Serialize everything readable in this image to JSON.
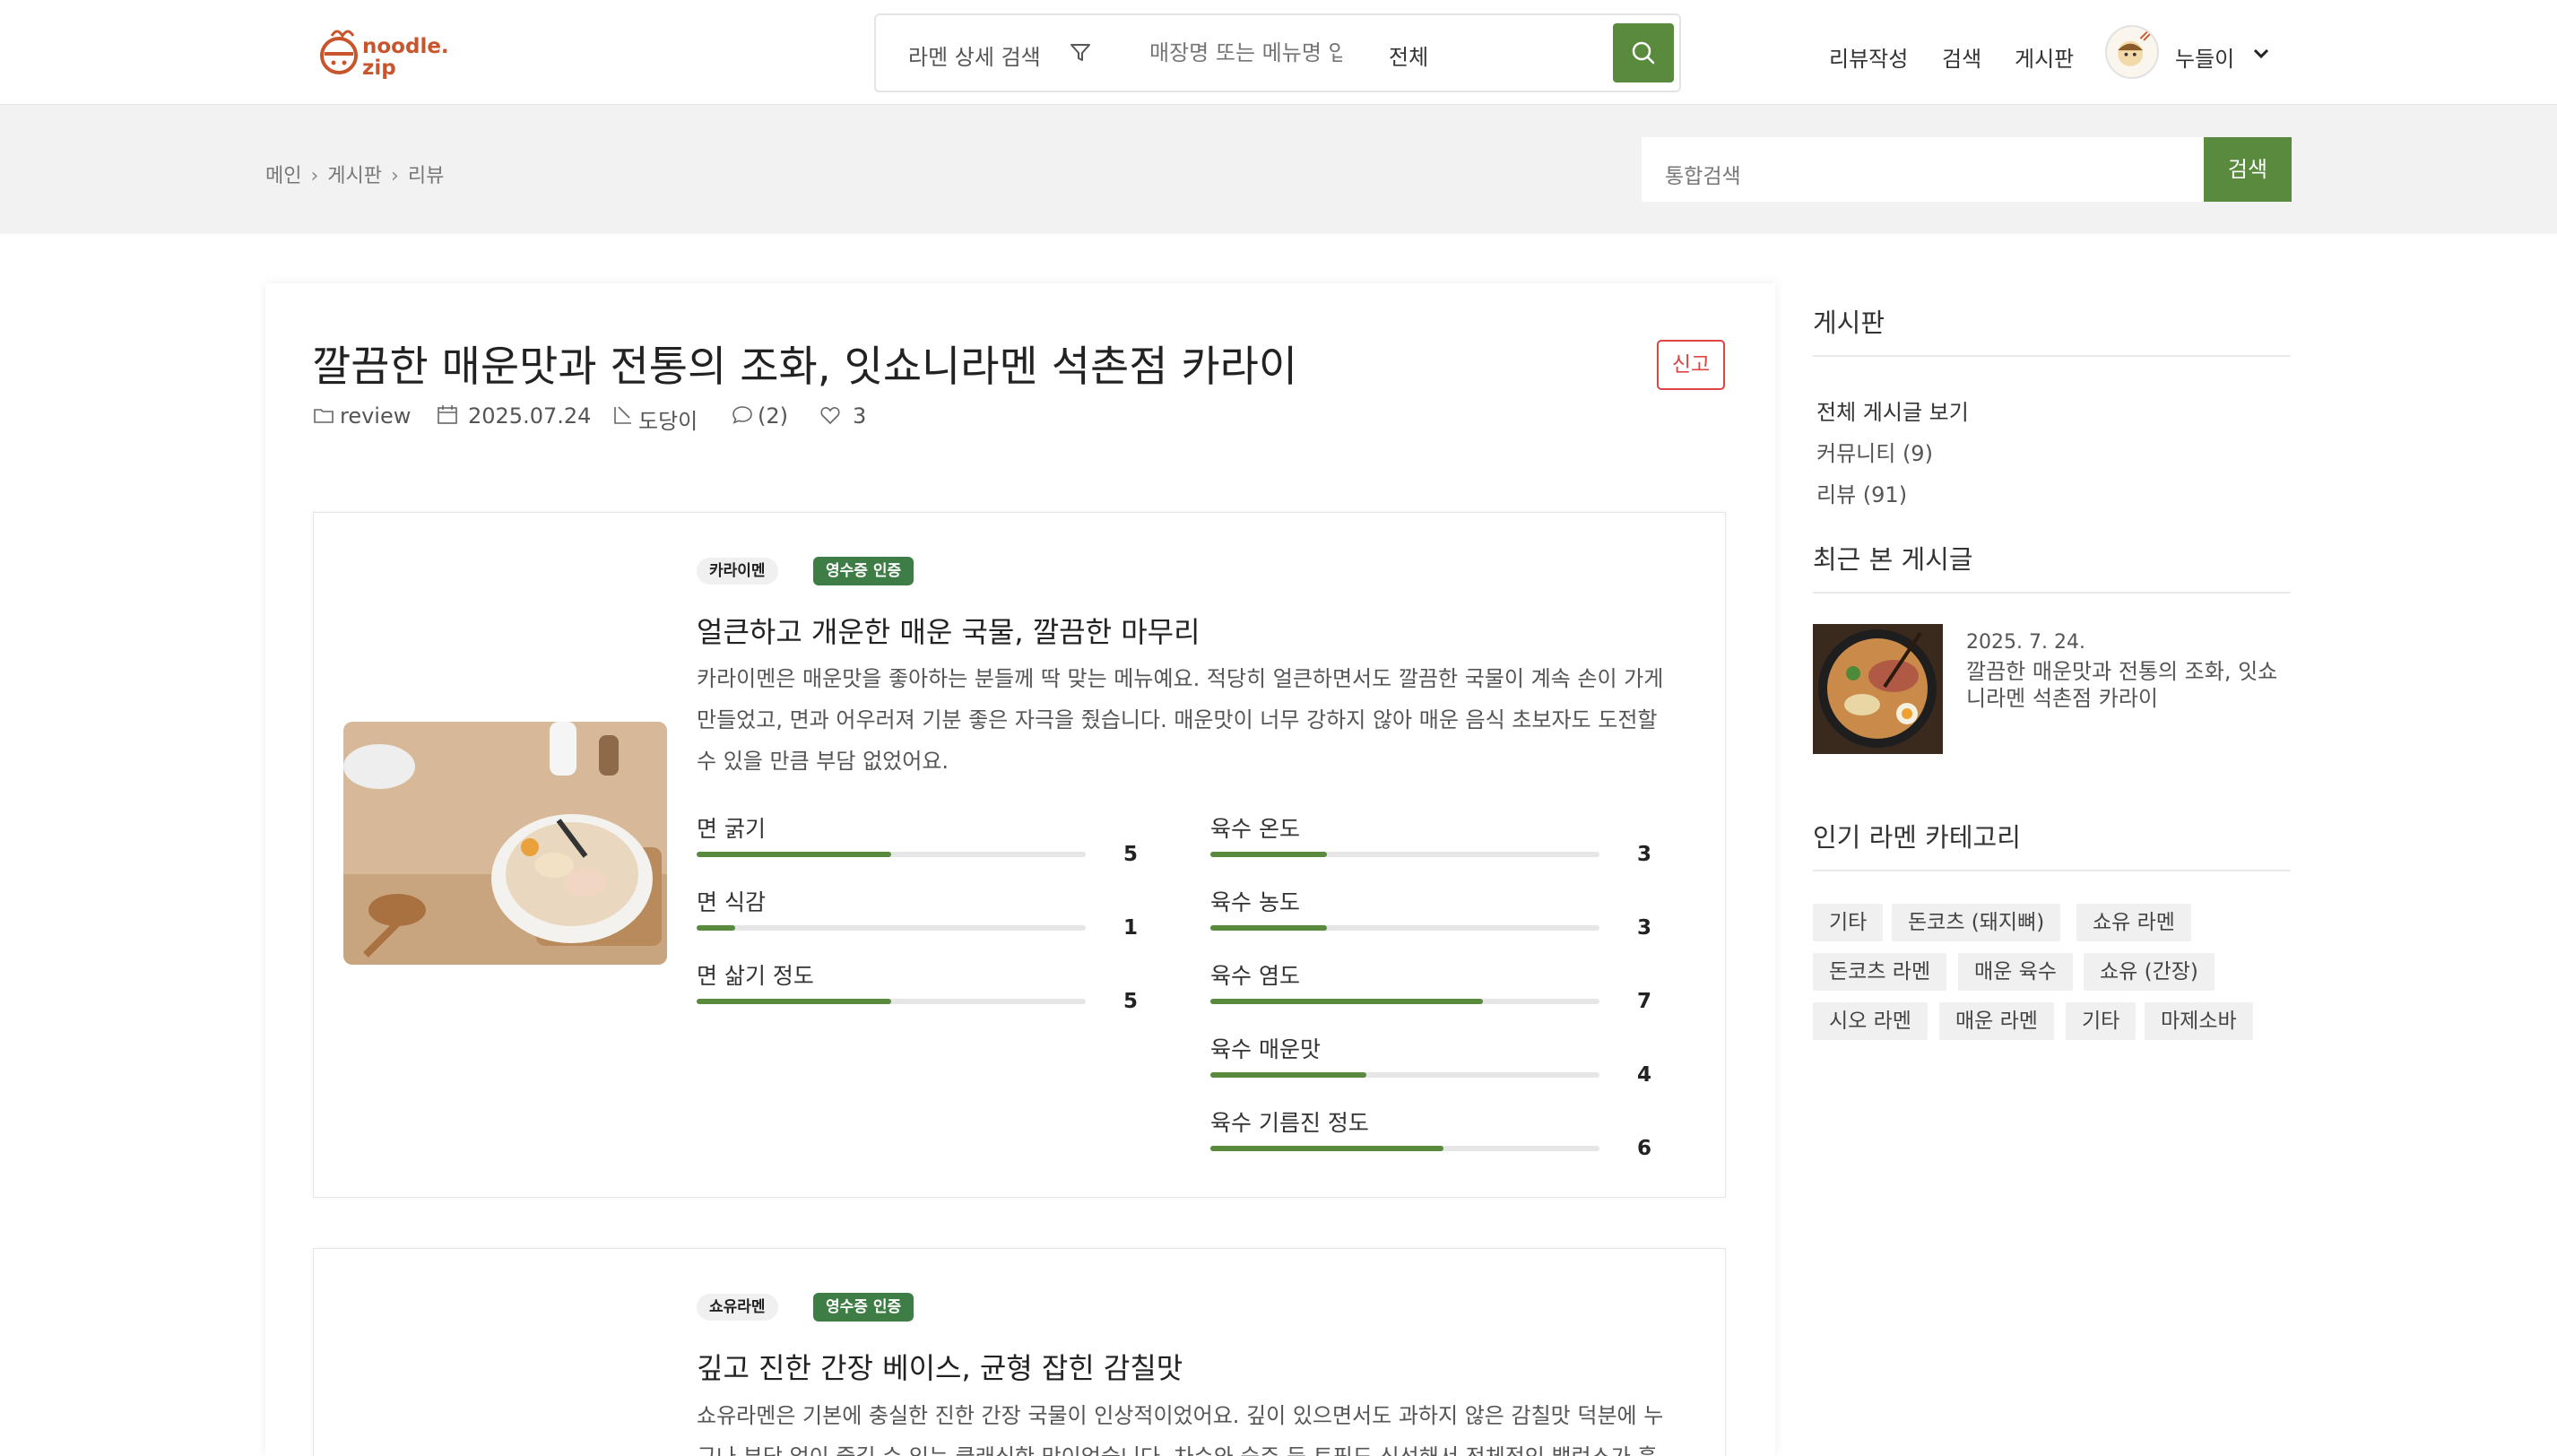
{
  "header": {
    "logo_text_line1": "noodle.",
    "logo_text_line2": "zip",
    "search_detail_label": "라멘 상세 검색",
    "store_placeholder": "매장명 또는 메뉴명 입력",
    "scope_label": "전체",
    "nav": [
      "리뷰작성",
      "검색",
      "게시판"
    ],
    "user_name": "누들이"
  },
  "subbar": {
    "breadcrumb": [
      "메인",
      "게시판",
      "리뷰"
    ],
    "global_search_placeholder": "통합검색",
    "global_search_button": "검색"
  },
  "post": {
    "title": "깔끔한 매운맛과 전통의 조화, 잇쇼니라멘 석촌점 카라이",
    "report_label": "신고",
    "category": "review",
    "date": "2025.07.24",
    "author": "도당이",
    "comments": "(2)",
    "likes": "3"
  },
  "reviews": [
    {
      "tag": "카라이멘",
      "cert": "영수증 인증",
      "title": "얼큰하고 개운한 매운 국물, 깔끔한 마무리",
      "body": "카라이멘은 매운맛을 좋아하는 분들께 딱 맞는 메뉴예요. 적당히 얼큰하면서도 깔끔한 국물이 계속 손이 가게 만들었고, 면과 어우러져 기분 좋은 자극을 줬습니다. 매운맛이 너무 강하지 않아 매운 음식 초보자도 도전할 수 있을 만큼 부담 없었어요.",
      "left_scores": [
        {
          "label": "면 굵기",
          "value": 5
        },
        {
          "label": "면 식감",
          "value": 1
        },
        {
          "label": "면 삶기 정도",
          "value": 5
        }
      ],
      "right_scores": [
        {
          "label": "육수 온도",
          "value": 3
        },
        {
          "label": "육수 농도",
          "value": 3
        },
        {
          "label": "육수 염도",
          "value": 7
        },
        {
          "label": "육수 매운맛",
          "value": 4
        },
        {
          "label": "육수 기름진 정도",
          "value": 6
        }
      ],
      "score_max": 10
    },
    {
      "tag": "쇼유라멘",
      "cert": "영수증 인증",
      "title": "깊고 진한 간장 베이스, 균형 잡힌 감칠맛",
      "body": "쇼유라멘은 기본에 충실한 진한 간장 국물이 인상적이었어요. 깊이 있으면서도 과하지 않은 감칠맛 덕분에 누구나 부담 없이 즐길 수 있는 클래식한 맛이었습니다. 차슈와 숙주 등 토핑도 신선해서 전체적인 밸런스가 훌"
    }
  ],
  "sidebar": {
    "board_heading": "게시판",
    "board_links": [
      "전체 게시글 보기",
      "커뮤니티 (9)",
      "리뷰 (91)"
    ],
    "recent_heading": "최근 본 게시글",
    "recent_date": "2025. 7. 24.",
    "recent_title": "깔끔한 매운맛과 전통의 조화, 잇쇼니라멘 석촌점 카라이",
    "popular_heading": "인기 라멘 카테고리",
    "chips": [
      "기타",
      "돈코츠 (돼지뼈)",
      "쇼유 라멘",
      "돈코츠 라멘",
      "매운 육수",
      "쇼유 (간장)",
      "시오 라멘",
      "매운 라멘",
      "기타",
      "마제소바"
    ]
  },
  "colors": {
    "accent_green": "#5a8a3e",
    "cert_green": "#3f7d46",
    "logo_orange": "#c8552c",
    "report_red": "#dd4444"
  }
}
